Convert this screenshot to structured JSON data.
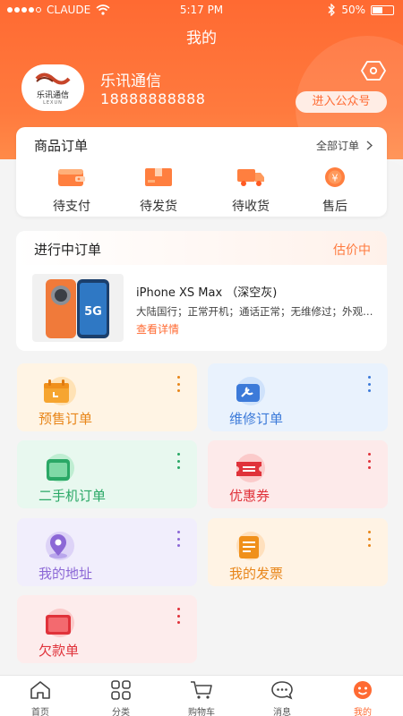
{
  "status_bar": {
    "carrier": "CLAUDE",
    "time": "5:17 PM",
    "battery": "50%",
    "battery_level": 0.5
  },
  "page": {
    "title": "我的"
  },
  "profile": {
    "name": "乐讯通信",
    "phone": "18888888888",
    "logo_text_cn": "乐讯通信",
    "logo_text_en": "LEXUN",
    "official_account_button": "进入公众号"
  },
  "orders": {
    "title": "商品订单",
    "all_label": "全部订单",
    "items": [
      {
        "label": "待支付",
        "icon": "wallet-icon"
      },
      {
        "label": "待发货",
        "icon": "package-icon"
      },
      {
        "label": "待收货",
        "icon": "truck-icon"
      },
      {
        "label": "售后",
        "icon": "yuan-icon"
      }
    ]
  },
  "ongoing": {
    "title": "进行中订单",
    "status": "估价中",
    "product_name": "iPhone XS Max （深空灰)",
    "product_desc": "大陆国行；正常开机；通话正常；无维修过；外观完好",
    "view_label": "查看详情"
  },
  "tiles": [
    {
      "label": "预售订单",
      "icon": "calendar-icon",
      "bg": "#fff4e4",
      "color": "#e8861a"
    },
    {
      "label": "维修订单",
      "icon": "wrench-icon",
      "bg": "#e9f2fd",
      "color": "#3c7ad9"
    },
    {
      "label": "二手机订单",
      "icon": "phone-icon",
      "bg": "#e8f8ef",
      "color": "#2aa866"
    },
    {
      "label": "优惠券",
      "icon": "ticket-icon",
      "bg": "#fdeaea",
      "color": "#e0323a"
    },
    {
      "label": "我的地址",
      "icon": "location-icon",
      "bg": "#f1eefc",
      "color": "#8c68d6"
    },
    {
      "label": "我的发票",
      "icon": "invoice-icon",
      "bg": "#fff3e4",
      "color": "#e8861a"
    },
    {
      "label": "欠款单",
      "icon": "debt-icon",
      "bg": "#fdecec",
      "color": "#e0323a"
    }
  ],
  "tabs": [
    {
      "label": "首页",
      "icon": "home-icon"
    },
    {
      "label": "分类",
      "icon": "grid-icon"
    },
    {
      "label": "购物车",
      "icon": "cart-icon"
    },
    {
      "label": "消息",
      "icon": "message-icon"
    },
    {
      "label": "我的",
      "icon": "profile-icon",
      "active": true
    }
  ],
  "colors": {
    "brand": "#ff6a32",
    "accent": "#ff7a3e"
  }
}
